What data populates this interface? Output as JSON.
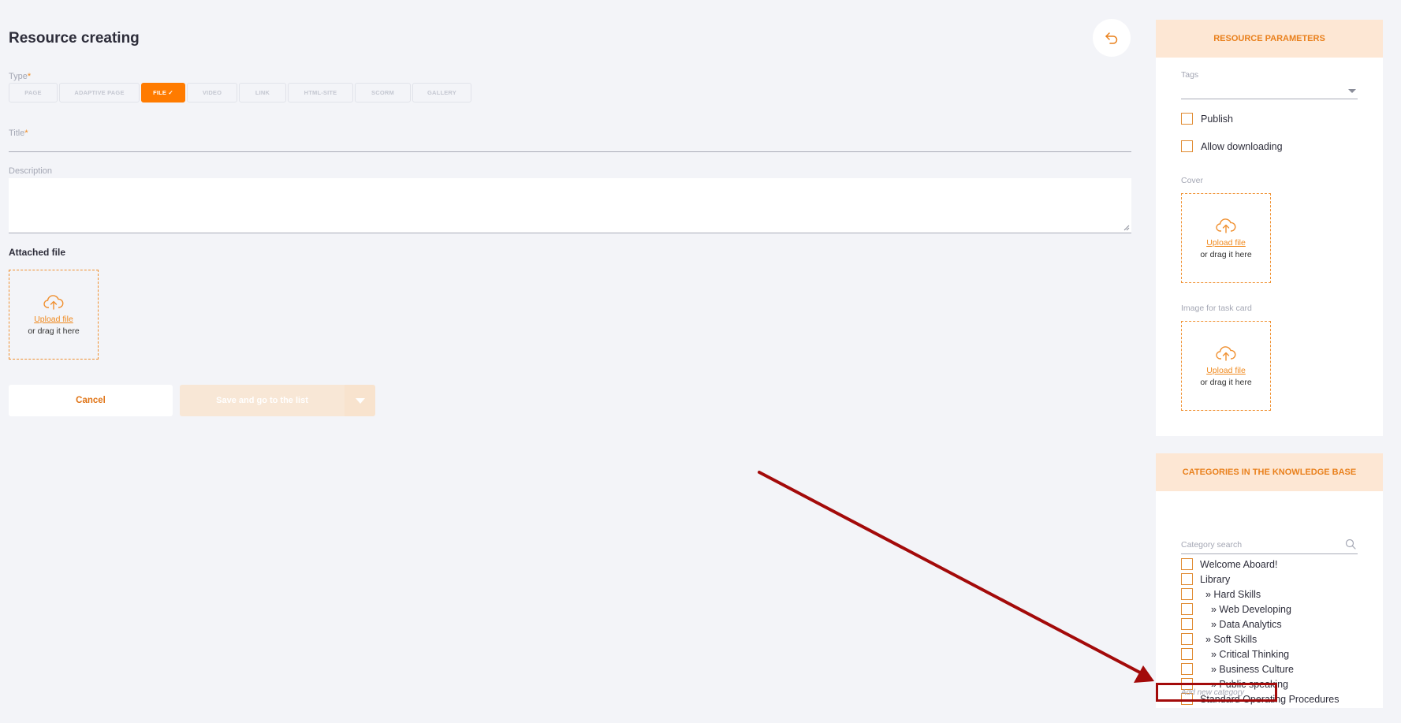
{
  "page": {
    "title": "Resource creating",
    "back_icon": "undo-arrow-icon"
  },
  "form": {
    "type_label": "Type",
    "required_mark": "*",
    "type_tabs": [
      {
        "label": "PAGE",
        "active": false
      },
      {
        "label": "ADAPTIVE PAGE",
        "active": false
      },
      {
        "label": "FILE ✓",
        "active": true
      },
      {
        "label": "VIDEO",
        "active": false
      },
      {
        "label": "LINK",
        "active": false
      },
      {
        "label": "HTML-SITE",
        "active": false
      },
      {
        "label": "SCORM",
        "active": false
      },
      {
        "label": "GALLERY",
        "active": false
      }
    ],
    "title_label": "Title",
    "title_value": "",
    "description_label": "Description",
    "description_value": "",
    "attached_label": "Attached file",
    "upload": {
      "link": "Upload file",
      "drag": "or drag it here",
      "icon": "cloud-upload-icon"
    },
    "cancel_label": "Cancel",
    "save_label": "Save and go to the list"
  },
  "sidebar": {
    "params_title": "RESOURCE PARAMETERS",
    "tags_label": "Tags",
    "publish_label": "Publish",
    "allow_download_label": "Allow downloading",
    "cover_label": "Cover",
    "task_card_label": "Image for task card",
    "categories_title": "CATEGORIES IN THE KNOWLEDGE BASE",
    "category_search_placeholder": "Category search",
    "categories": [
      "Welcome Aboard!",
      "Library",
      "» Hard Skills",
      "» Web Developing",
      "» Data Analytics",
      "» Soft Skills",
      "» Critical Thinking",
      "» Business Culture",
      "» Public speaking",
      "Standard Operating Procedures"
    ],
    "add_category_placeholder": "Add new category"
  },
  "colors": {
    "accent": "#ff7b00",
    "panel_header_bg": "#fde7d4",
    "annotation": "#a30a0a"
  }
}
